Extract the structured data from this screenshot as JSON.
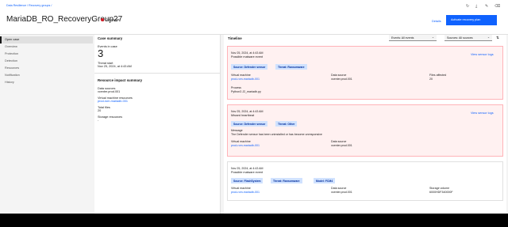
{
  "header": {
    "breadcrumb": "Data Resilience / Recovery groups /",
    "title": "MariaDB_RO_RecoveryGroup27",
    "status": "Open case",
    "details_link": "Details",
    "primary_action": "Activate recovery plan",
    "icons": [
      "refresh-icon",
      "download-icon",
      "edit-icon",
      "delete-icon"
    ]
  },
  "sidebar": {
    "items": [
      "Open case",
      "Overview",
      "Protection",
      "Detection",
      "Resources",
      "Notification",
      "History"
    ],
    "active": "Open case"
  },
  "case_summary": {
    "heading": "Case summary",
    "events_label": "Events in case",
    "events_value": "3",
    "threat_start_label": "Threat start",
    "threat_start_value": "Nov 25, 2024, at 4:43 AM"
  },
  "resource_impact": {
    "heading": "Resource impact summary",
    "data_sources_label": "Data sources",
    "data_sources_value": "vcenter.prod.001",
    "vm_label": "Virtual machine resources",
    "vm_value": "prod-rom-mariadb-001",
    "total_files_label": "Total files",
    "total_files_value": "20",
    "storage_label": "Storage resources",
    "storage_value": "-"
  },
  "timeline": {
    "heading": "Timeline",
    "events_filter": "Events: All events",
    "sources_filter": "Sources: All sources",
    "events": [
      {
        "date": "Nov 25, 2024, at 4:43 AM",
        "title": "Possible malware event",
        "log_link": "View sensor logs",
        "tags": [
          "Source: Defender sensor",
          "Threat: Ransomware"
        ],
        "vm_label": "Virtual machine",
        "vm_value": "prod-rom-mariadb-001",
        "ds_label": "Data source",
        "ds_value": "vcenter.prod.001",
        "files_label": "Files affected",
        "files_value": "20",
        "process_label": "Process",
        "process_value": "Python3 J2_mariadb.py"
      },
      {
        "date": "Nov 25, 2024, at 4:43 AM",
        "title": "Missed heartbeat",
        "log_link": "View sensor logs",
        "tags": [
          "Source: Defender sensor",
          "Threat: Other"
        ],
        "message_label": "Message",
        "message_value": "The Defender sensor has been uninstalled or has become unresponsive",
        "vm_label": "Virtual machine",
        "vm_value": "prod-rom-mariadb-001",
        "ds_label": "Data source",
        "ds_value": "vcenter.prod.001"
      },
      {
        "date": "Nov 25, 2024, at 4:43 AM",
        "title": "Possible malware event",
        "tags": [
          "Source: FlashSystem",
          "Threat: Ransomware",
          "Model: FCM4"
        ],
        "vm_label": "Virtual machine",
        "vm_value": "prod-rom-mariadb-001",
        "ds_label": "Data source",
        "ds_value": "vcenter.prod.001",
        "storage_label": "Storage volume",
        "storage_value": "6000HDF340000F"
      }
    ]
  }
}
